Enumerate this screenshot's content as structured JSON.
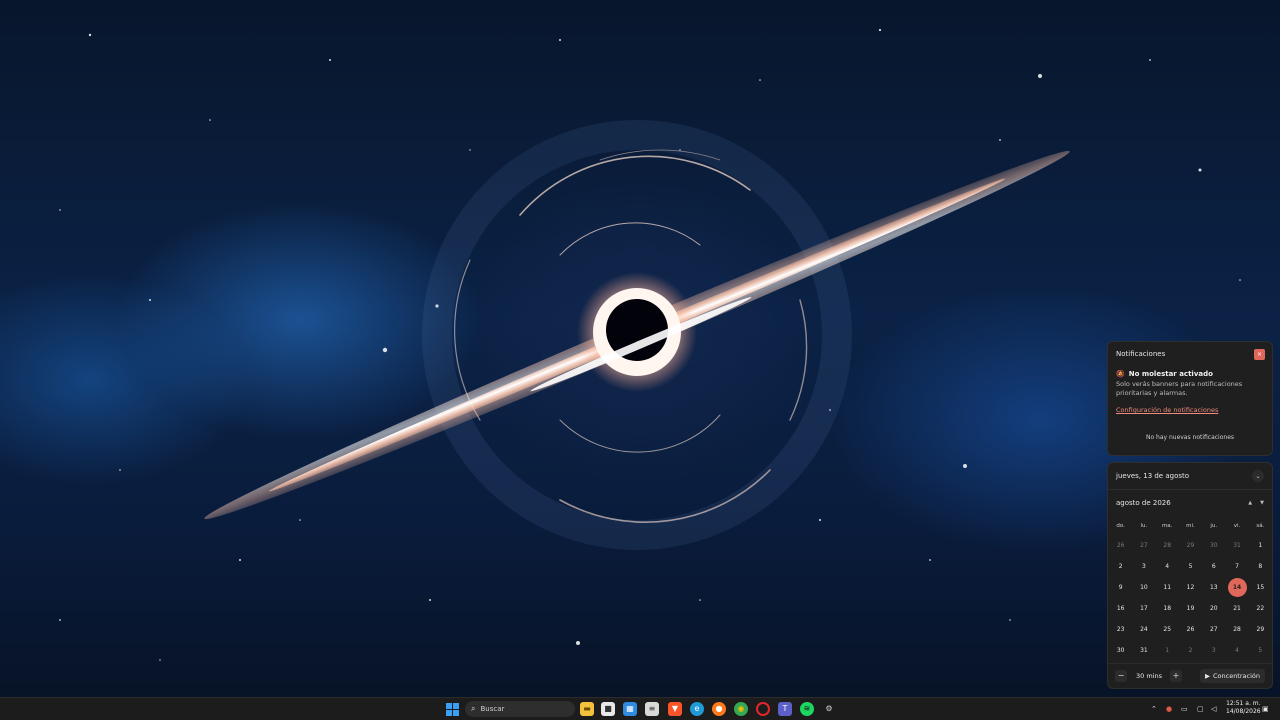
{
  "notifications": {
    "title": "Notificaciones",
    "close_glyph": "×",
    "dnd_title": "No molestar activado",
    "dnd_description": "Solo verás banners para notificaciones prioritarias y alarmas.",
    "settings_link": "Configuración de notificaciones",
    "empty_text": "No hay nuevas notificaciones"
  },
  "calendar": {
    "header_date": "jueves, 13 de agosto",
    "month_label": "agosto de 2026",
    "weekdays": [
      "do.",
      "lu.",
      "ma.",
      "mi.",
      "ju.",
      "vi.",
      "sá."
    ],
    "weeks": [
      [
        "26",
        "27",
        "28",
        "29",
        "30",
        "31",
        "1"
      ],
      [
        "2",
        "3",
        "4",
        "5",
        "6",
        "7",
        "8"
      ],
      [
        "9",
        "10",
        "11",
        "12",
        "13",
        "14",
        "15"
      ],
      [
        "16",
        "17",
        "18",
        "19",
        "20",
        "21",
        "22"
      ],
      [
        "23",
        "24",
        "25",
        "26",
        "27",
        "28",
        "29"
      ],
      [
        "30",
        "31",
        "1",
        "2",
        "3",
        "4",
        "5"
      ]
    ],
    "today": "14",
    "focus_minus": "−",
    "focus_time": "30 mins",
    "focus_plus": "+",
    "focus_button": "Concentración"
  },
  "taskbar": {
    "search_placeholder": "Buscar",
    "clock_time": "12:51 a. m.",
    "clock_date": "14/08/2026"
  },
  "colors": {
    "accent": "#e0685a",
    "panel_bg": "#1f1f1f",
    "taskbar_bg": "#1c1c1c"
  }
}
